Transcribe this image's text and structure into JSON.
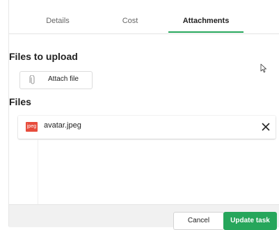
{
  "tabs": [
    {
      "label": "Details",
      "active": false
    },
    {
      "label": "Cost",
      "active": false
    },
    {
      "label": "Attachments",
      "active": true
    }
  ],
  "upload_section": {
    "title": "Files to upload",
    "attach_button_label": "Attach file",
    "attach_icon": "paperclip-icon"
  },
  "files_section": {
    "title": "Files",
    "files": [
      {
        "badge": "jpeg",
        "name": "avatar.jpeg",
        "remove_icon": "close-icon"
      }
    ]
  },
  "footer": {
    "cancel_label": "Cancel",
    "update_label": "Update task"
  },
  "colors": {
    "accent": "#26a65b",
    "jpeg_badge": "#e74c3c"
  }
}
